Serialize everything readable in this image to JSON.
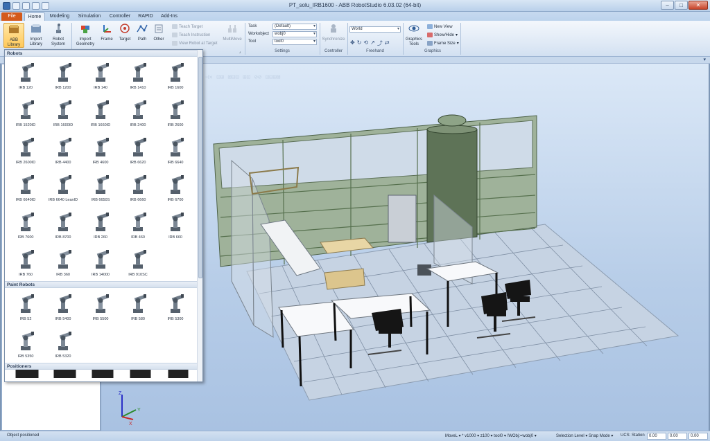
{
  "window": {
    "title": "PT_solu_IRB1600 - ABB RobotStudio 6.03.02 (64-bit)"
  },
  "tabs": [
    "File",
    "Home",
    "Modeling",
    "Simulation",
    "Controller",
    "RAPID",
    "Add-Ins"
  ],
  "ribbon": {
    "abb_library": "ABB Library",
    "import_library": "Import Library",
    "robot_system": "Robot System",
    "import_geometry": "Import Geometry",
    "frame": "Frame",
    "target": "Target",
    "path": "Path",
    "other": "Other",
    "teach_target": "Teach Target",
    "teach_instruction": "Teach Instruction",
    "view_robot_at_target": "View Robot at Target",
    "multimove": "MultiMove",
    "task_label": "Task",
    "task_value": "(Default)",
    "workobject_label": "Workobject",
    "workobject_value": "wobj0",
    "tool_label": "Tool",
    "tool_value": "tool0",
    "settings_group": "Settings",
    "synchronize": "Synchronize",
    "controller_group": "Controller",
    "world_value": "World",
    "freehand_group": "Freehand",
    "graphics_tools": "Graphics Tools",
    "new_view": "New View",
    "show_hide": "Show/Hide",
    "frame_size": "Frame Size",
    "graphics_group": "Graphics"
  },
  "gallery": {
    "sections": [
      {
        "title": "Robots",
        "items": [
          "IRB 120",
          "IRB 1200",
          "IRB 140",
          "IRB 1410",
          "IRB 1600",
          "IRB 1520ID",
          "IRB 1600ID",
          "IRB 1660ID",
          "IRB 2400",
          "IRB 2600",
          "IRB 2600ID",
          "IRB 4400",
          "IRB 4600",
          "IRB 6620",
          "IRB 6640",
          "IRB 6640ID",
          "IRB 6640 LeanID",
          "IRB 6650S",
          "IRB 6660",
          "IRB 6700",
          "IRB 7600",
          "IRB 8700",
          "IRB 260",
          "IRB 460",
          "IRB 660",
          "IRB 760",
          "IRB 360",
          "IRB 14000",
          "IRB 910SC"
        ]
      },
      {
        "title": "Paint Robots",
        "items": [
          "IRB 52",
          "IRB 5400",
          "IRB 5500",
          "IRB 580",
          "IRB 5300",
          "IRB 5350",
          "IRB 5320"
        ]
      },
      {
        "title": "Positioners",
        "items": []
      }
    ]
  },
  "viewport": {
    "axis_labels": {
      "x": "X",
      "y": "Y",
      "z": "Z"
    }
  },
  "statusbar": {
    "message": "Object positioned",
    "instruction": "MoveL ▾ * v1000 ▾ z100 ▾ tool0 ▾ \\WObj:=wobj0 ▾",
    "selection": "Selection Level ▾ Snap Mode ▾",
    "ucs": "UCS: Station",
    "coords": [
      "0.00",
      "0.00",
      "0.00"
    ]
  }
}
